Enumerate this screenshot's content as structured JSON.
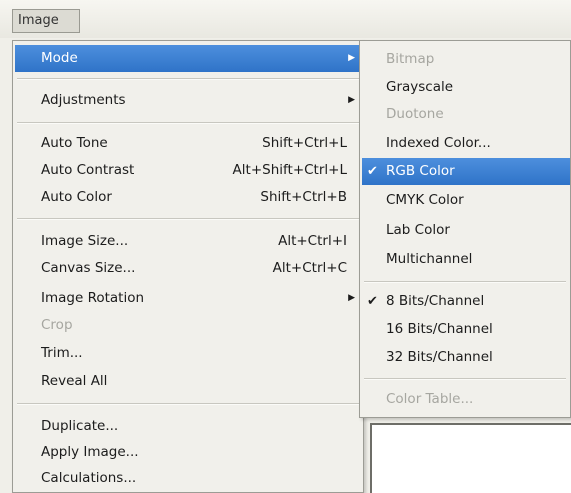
{
  "menubar": {
    "image_label": "Image"
  },
  "main_menu": {
    "mode": "Mode",
    "adjustments": "Adjustments",
    "auto_tone": "Auto Tone",
    "auto_tone_shortcut": "Shift+Ctrl+L",
    "auto_contrast": "Auto Contrast",
    "auto_contrast_shortcut": "Alt+Shift+Ctrl+L",
    "auto_color": "Auto Color",
    "auto_color_shortcut": "Shift+Ctrl+B",
    "image_size": "Image Size...",
    "image_size_shortcut": "Alt+Ctrl+I",
    "canvas_size": "Canvas Size...",
    "canvas_size_shortcut": "Alt+Ctrl+C",
    "image_rotation": "Image Rotation",
    "crop": "Crop",
    "trim": "Trim...",
    "reveal_all": "Reveal All",
    "duplicate": "Duplicate...",
    "apply_image": "Apply Image...",
    "calculations": "Calculations..."
  },
  "mode_submenu": {
    "bitmap": "Bitmap",
    "grayscale": "Grayscale",
    "duotone": "Duotone",
    "indexed_color": "Indexed Color...",
    "rgb_color": "RGB Color",
    "cmyk_color": "CMYK Color",
    "lab_color": "Lab Color",
    "multichannel": "Multichannel",
    "bits8": "8 Bits/Channel",
    "bits16": "16 Bits/Channel",
    "bits32": "32 Bits/Channel",
    "color_table": "Color Table..."
  },
  "glyphs": {
    "check": "✔",
    "arrow": "▶"
  },
  "colors": {
    "highlight": "#3a7fd2",
    "disabled_text": "#a6a6a0",
    "menu_bg": "#f1f0eb"
  }
}
